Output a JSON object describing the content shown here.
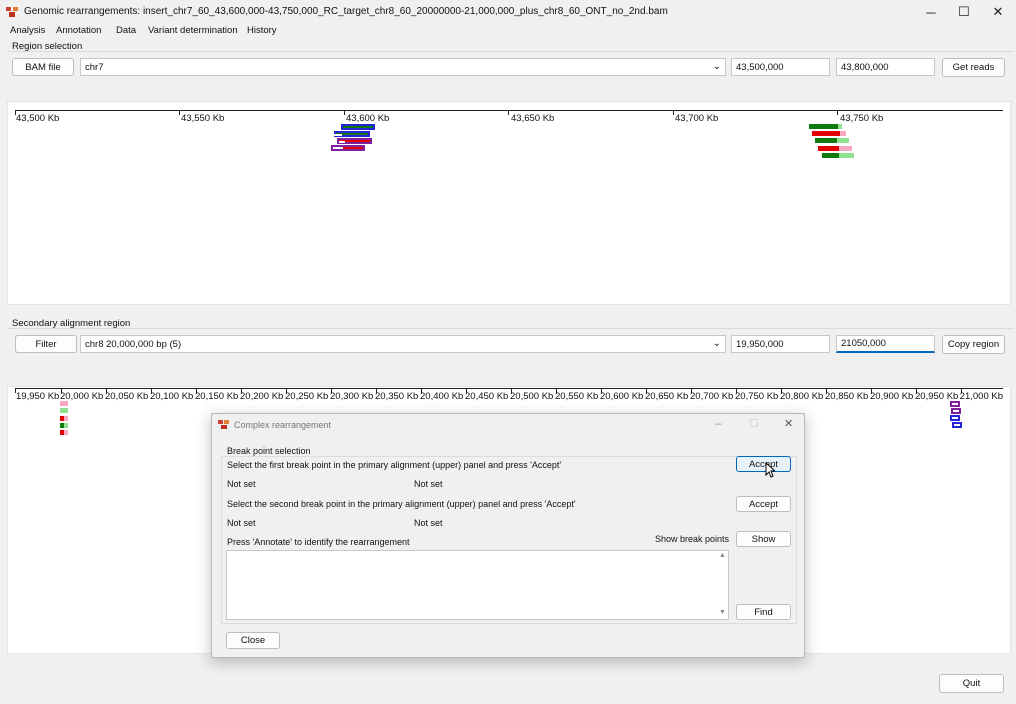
{
  "window": {
    "title": "Genomic rearrangements: insert_chr7_60_43,600,000-43,750,000_RC_target_chr8_60_20000000-21,000,000_plus_chr8_60_ONT_no_2nd.bam",
    "minimize": "─",
    "maximize": "☐",
    "close": "✕"
  },
  "menu": [
    "Analysis",
    "Annotation",
    "Data",
    "Variant determination",
    "History"
  ],
  "region": {
    "label": "Region selection",
    "bam_button": "BAM file",
    "chrom": "chr7",
    "start": "43,500,000",
    "end": "43,800,000",
    "get_reads": "Get reads"
  },
  "primary_ticks": [
    "43,500 Kb",
    "43,550 Kb",
    "43,600 Kb",
    "43,650 Kb",
    "43,700 Kb",
    "43,750 Kb"
  ],
  "secondary": {
    "label": "Secondary alignment region",
    "filter_button": "Filter",
    "chrom": "chr8 20,000,000 bp (5)",
    "start": "19,950,000",
    "end": "21050,000",
    "copy_button": "Copy region"
  },
  "secondary_ticks": [
    "19,950 Kb",
    "20,000 Kb",
    "20,050 Kb",
    "20,100 Kb",
    "20,150 Kb",
    "20,200 Kb",
    "20,250 Kb",
    "20,300 Kb",
    "20,350 Kb",
    "20,400 Kb",
    "20,450 Kb",
    "20,500 Kb",
    "20,550 Kb",
    "20,600 Kb",
    "20,650 Kb",
    "20,700 Kb",
    "20,750 Kb",
    "20,800 Kb",
    "20,850 Kb",
    "20,900 Kb",
    "20,950 Kb",
    "21,000 Kb"
  ],
  "dialog": {
    "title": "Complex rearrangement",
    "group": "Break point selection",
    "first_instruction": "Select the first break point in the primary alignment (upper) panel and press 'Accept'",
    "second_instruction": "Select the second break point in the primary alignment (upper) panel and press 'Accept'",
    "not_set": "Not set",
    "accept": "Accept",
    "annotate_instruction": "Press 'Annotate' to identify the rearrangement",
    "show_label": "Show break points",
    "show_button": "Show",
    "find_button": "Find",
    "close_button": "Close"
  },
  "quit_button": "Quit",
  "colors": {
    "accent": "#0067c0",
    "dark_green": "#0e7a0e",
    "red": "#e00000",
    "pink": "#f5a8c0",
    "light_green": "#8fe08f",
    "blue": "#2424d8",
    "purple": "#8020a0"
  }
}
